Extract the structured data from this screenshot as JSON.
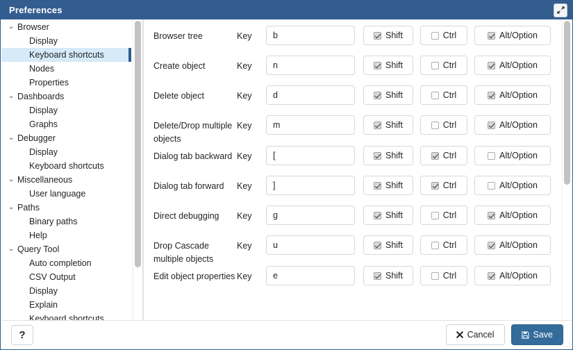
{
  "window": {
    "title": "Preferences",
    "maximize_icon": "maximize-diagonal-icon",
    "titlebar_color": "#335d8f"
  },
  "sidebar": {
    "selected": "Keyboard shortcuts",
    "items": [
      {
        "label": "Browser",
        "type": "group",
        "expanded": true
      },
      {
        "label": "Display",
        "type": "leaf"
      },
      {
        "label": "Keyboard shortcuts",
        "type": "leaf",
        "selected": true
      },
      {
        "label": "Nodes",
        "type": "leaf"
      },
      {
        "label": "Properties",
        "type": "leaf"
      },
      {
        "label": "Dashboards",
        "type": "group",
        "expanded": true
      },
      {
        "label": "Display",
        "type": "leaf"
      },
      {
        "label": "Graphs",
        "type": "leaf"
      },
      {
        "label": "Debugger",
        "type": "group",
        "expanded": true
      },
      {
        "label": "Display",
        "type": "leaf"
      },
      {
        "label": "Keyboard shortcuts",
        "type": "leaf"
      },
      {
        "label": "Miscellaneous",
        "type": "group",
        "expanded": true
      },
      {
        "label": "User language",
        "type": "leaf"
      },
      {
        "label": "Paths",
        "type": "group",
        "expanded": true
      },
      {
        "label": "Binary paths",
        "type": "leaf"
      },
      {
        "label": "Help",
        "type": "leaf"
      },
      {
        "label": "Query Tool",
        "type": "group",
        "expanded": true
      },
      {
        "label": "Auto completion",
        "type": "leaf"
      },
      {
        "label": "CSV Output",
        "type": "leaf"
      },
      {
        "label": "Display",
        "type": "leaf"
      },
      {
        "label": "Explain",
        "type": "leaf"
      },
      {
        "label": "Keyboard shortcuts",
        "type": "leaf"
      }
    ],
    "chevron_glyph": "⌄"
  },
  "main": {
    "key_word": "Key",
    "modifier_labels": {
      "shift": "Shift",
      "ctrl": "Ctrl",
      "alt": "Alt/Option"
    },
    "rows": [
      {
        "label": "Browser tree",
        "key": "b",
        "shift": true,
        "ctrl": false,
        "alt": true
      },
      {
        "label": "Create object",
        "key": "n",
        "shift": true,
        "ctrl": false,
        "alt": true
      },
      {
        "label": "Delete object",
        "key": "d",
        "shift": true,
        "ctrl": false,
        "alt": true
      },
      {
        "label": "Delete/Drop multiple objects",
        "key": "m",
        "shift": true,
        "ctrl": false,
        "alt": true
      },
      {
        "label": "Dialog tab backward",
        "key": "[",
        "shift": true,
        "ctrl": true,
        "alt": false
      },
      {
        "label": "Dialog tab forward",
        "key": "]",
        "shift": true,
        "ctrl": true,
        "alt": false
      },
      {
        "label": "Direct debugging",
        "key": "g",
        "shift": true,
        "ctrl": false,
        "alt": true
      },
      {
        "label": "Drop Cascade multiple objects",
        "key": "u",
        "shift": true,
        "ctrl": false,
        "alt": true
      },
      {
        "label": "Edit object properties",
        "key": "e",
        "shift": true,
        "ctrl": false,
        "alt": true
      }
    ]
  },
  "footer": {
    "help_label": "?",
    "cancel_label": "Cancel",
    "cancel_icon": "close-x-icon",
    "save_label": "Save",
    "save_icon": "floppy-disk-icon",
    "save_color": "#336c9b"
  }
}
